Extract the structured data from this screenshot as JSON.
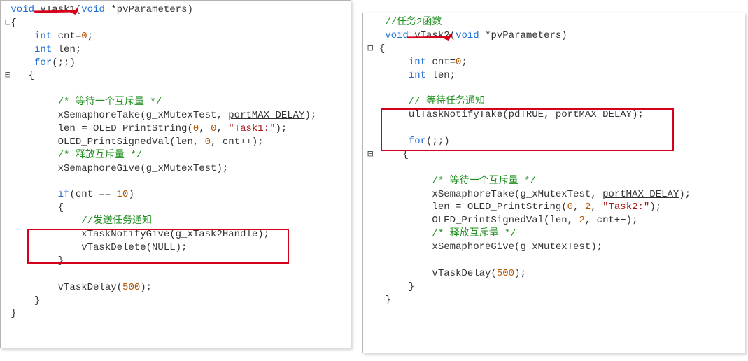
{
  "left": {
    "sig": {
      "void1": "void",
      "fn": "vTask1",
      "void2": "void",
      "param": " *pvParameters)"
    },
    "open": "{",
    "decl1": {
      "kw": "int",
      "rest": " cnt=",
      "zero": "0",
      "semi": ";"
    },
    "decl2": {
      "kw": "int",
      "rest": " len;"
    },
    "for": {
      "kw": "for",
      "rest": "(;;)"
    },
    "open2": "{",
    "c1": "/* 等待一个互斥量 */",
    "l1a": "xSemaphoreTake(g_xMutexTest, ",
    "l1b": "portMAX_DELAY",
    "l1c": ");",
    "l2a": "len = OLED_PrintString(",
    "l2n1": "0",
    "l2s1": ", ",
    "l2n2": "0",
    "l2s2": ", ",
    "l2str": "\"Task1:\"",
    "l2end": ");",
    "l3a": "OLED_PrintSignedVal(len, ",
    "l3n": "0",
    "l3end": ", cnt++);",
    "c2": "/* 释放互斥量 */",
    "l4": "xSemaphoreGive(g_xMutexTest);",
    "ifkw": "if",
    "ifrest": "(cnt == ",
    "ifn": "10",
    "ifend": ")",
    "open3": "{",
    "c3": "//发送任务通知",
    "l5": "xTaskNotifyGive(g_xTask2Handle);",
    "l6": "vTaskDelete(NULL);",
    "close3": "}",
    "l7a": "vTaskDelay(",
    "l7n": "500",
    "l7end": ");",
    "close2": "}",
    "close": "}"
  },
  "right": {
    "c0": "//任务2函数",
    "sig": {
      "void1": "void",
      "fn": "vTask2",
      "void2": "void",
      "param": " *pvParameters)"
    },
    "open": "{",
    "decl1": {
      "kw": "int",
      "rest": " cnt=",
      "zero": "0",
      "semi": ";"
    },
    "decl2": {
      "kw": "int",
      "rest": " len;"
    },
    "c1": "// 等待任务通知",
    "l1a": "ulTaskNotifyTake(pdTRUE, ",
    "l1b": "portMAX_DELAY",
    "l1c": ");",
    "for": {
      "kw": "for",
      "rest": "(;;)"
    },
    "open2": "{",
    "c2": "/* 等待一个互斥量 */",
    "l2a": "xSemaphoreTake(g_xMutexTest, ",
    "l2b": "portMAX_DELAY",
    "l2c": ");",
    "l3a": "len = OLED_PrintString(",
    "l3n1": "0",
    "l3s1": ", ",
    "l3n2": "2",
    "l3s2": ", ",
    "l3str": "\"Task2:\"",
    "l3end": ");",
    "l4a": "OLED_PrintSignedVal(len, ",
    "l4n": "2",
    "l4end": ", cnt++);",
    "c3": "/* 释放互斥量 */",
    "l5": "xSemaphoreGive(g_xMutexTest);",
    "l6a": "vTaskDelay(",
    "l6n": "500",
    "l6end": ");",
    "close2": "}",
    "close": "}"
  }
}
